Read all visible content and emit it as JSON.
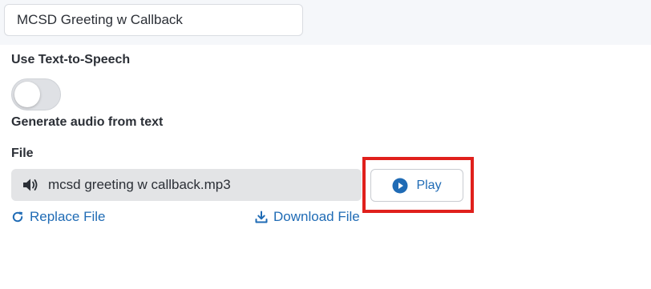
{
  "greeting": {
    "name_value": "MCSD Greeting w Callback"
  },
  "tts": {
    "label": "Use Text-to-Speech",
    "enabled": false,
    "helper": "Generate audio from text"
  },
  "file": {
    "label": "File",
    "name": "mcsd greeting w callback.mp3",
    "play_label": "Play",
    "replace_label": "Replace File",
    "download_label": "Download File"
  },
  "icons": {
    "file_icon": "speaker-icon",
    "play_icon": "play-circle-icon",
    "replace_icon": "refresh-icon",
    "download_icon": "download-icon"
  },
  "colors": {
    "link": "#1f6bb5",
    "highlight": "#e0201c",
    "toggle_off": "#dfe1e5",
    "file_box": "#e3e4e6"
  }
}
